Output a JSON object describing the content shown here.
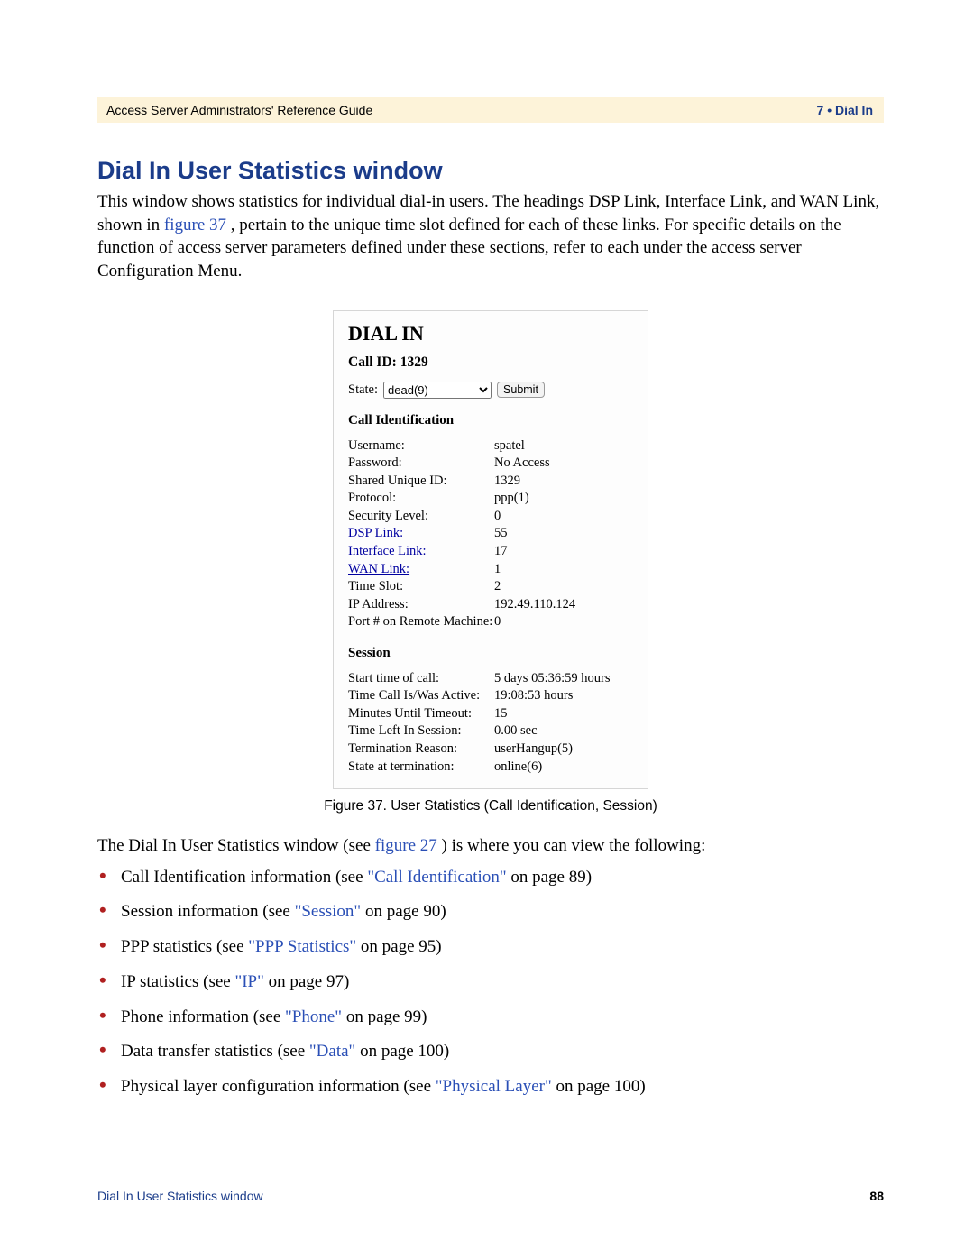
{
  "header": {
    "left": "Access Server Administrators' Reference Guide",
    "right": "7 • Dial In"
  },
  "title": "Dial In User Statistics window",
  "intro_parts": {
    "p1a": "This window shows statistics for individual dial-in users. The headings DSP Link, Interface Link, and WAN Link, shown in ",
    "p1_link": "figure 37",
    "p1b": ", pertain to the unique time slot defined for each of these links. For specific details on the function of access server parameters defined under these sections, refer to each under the access server Configuration Menu."
  },
  "figure": {
    "h1": "DIAL IN",
    "call_id": "Call ID: 1329",
    "state_label": "State:",
    "state_value": "dead(9)",
    "submit_label": "Submit",
    "h_call_ident": "Call Identification",
    "call_ident": [
      {
        "k": "Username:",
        "v": "spatel"
      },
      {
        "k": "Password:",
        "v": "No Access"
      },
      {
        "k": "Shared Unique ID:",
        "v": "1329"
      },
      {
        "k": "Protocol:",
        "v": "ppp(1)"
      },
      {
        "k": "Security Level:",
        "v": "0"
      },
      {
        "k": "DSP Link:",
        "v": "55",
        "link": true
      },
      {
        "k": "Interface Link:",
        "v": "17",
        "link": true
      },
      {
        "k": "WAN Link:",
        "v": "1",
        "link": true
      },
      {
        "k": "Time Slot:",
        "v": "2"
      },
      {
        "k": "IP Address:",
        "v": "192.49.110.124"
      },
      {
        "k": "Port # on Remote Machine:",
        "v": "0"
      }
    ],
    "h_session": "Session",
    "session": [
      {
        "k": "Start time of call:",
        "v": "5 days 05:36:59 hours"
      },
      {
        "k": "Time Call Is/Was Active:",
        "v": "19:08:53 hours"
      },
      {
        "k": "Minutes Until Timeout:",
        "v": "15"
      },
      {
        "k": "Time Left In Session:",
        "v": "0.00 sec"
      },
      {
        "k": "Termination Reason:",
        "v": "userHangup(5)"
      },
      {
        "k": "State at termination:",
        "v": "online(6)"
      }
    ]
  },
  "caption": "Figure 37. User Statistics (Call Identification, Session)",
  "after_fig": {
    "a": "The Dial In User Statistics window (see ",
    "link": "figure 27",
    "b": ") is where you can view the following:"
  },
  "bullets": [
    {
      "a": "Call Identification information (see ",
      "link": "\"Call Identification\"",
      "b": " on page 89)"
    },
    {
      "a": "Session information (see ",
      "link": "\"Session\"",
      "b": " on page 90)"
    },
    {
      "a": "PPP statistics (see ",
      "link": "\"PPP Statistics\"",
      "b": " on page 95)"
    },
    {
      "a": "IP statistics (see ",
      "link": "\"IP\"",
      "b": " on page 97)"
    },
    {
      "a": "Phone information (see ",
      "link": "\"Phone\"",
      "b": " on page 99)"
    },
    {
      "a": "Data transfer statistics (see ",
      "link": "\"Data\"",
      "b": " on page 100)"
    },
    {
      "a": "Physical layer configuration information (see ",
      "link": "\"Physical Layer\"",
      "b": " on page 100)"
    }
  ],
  "footer": {
    "left": "Dial In User Statistics window",
    "right": "88"
  }
}
